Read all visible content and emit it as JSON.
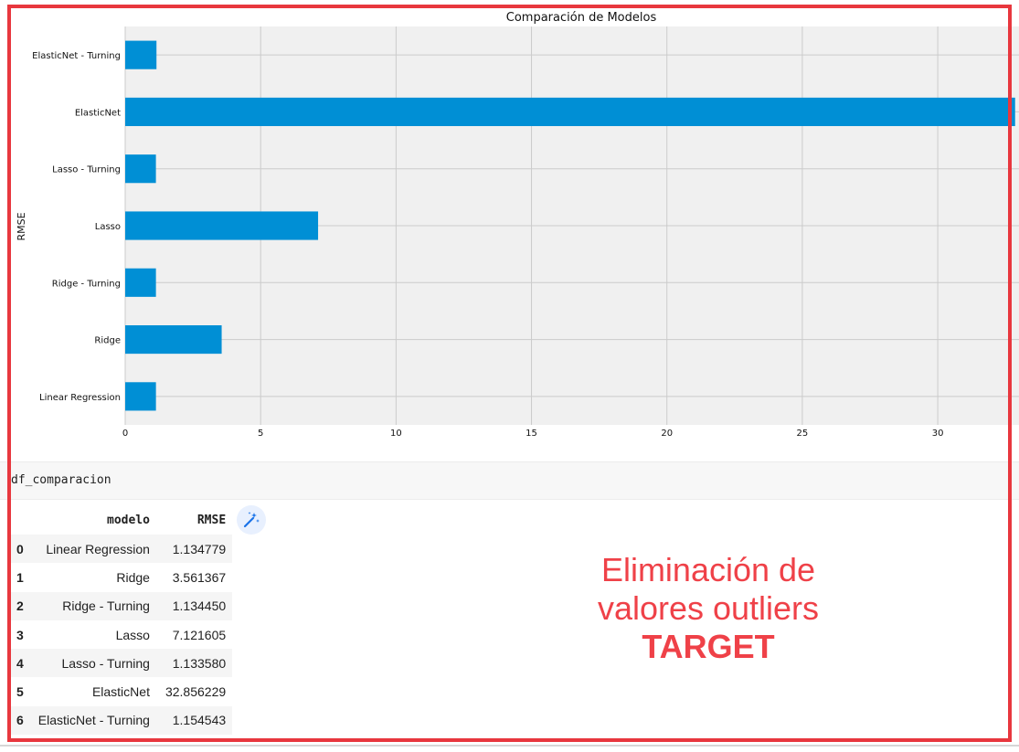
{
  "chart_data": {
    "type": "bar",
    "orientation": "horizontal",
    "title": "Comparación de Modelos",
    "xlabel": "",
    "ylabel": "RMSE",
    "categories": [
      "Linear Regression",
      "Ridge",
      "Ridge - Turning",
      "Lasso",
      "Lasso - Turning",
      "ElasticNet",
      "ElasticNet - Turning"
    ],
    "values": [
      1.134779,
      3.561367,
      1.13445,
      7.121605,
      1.13358,
      32.856229,
      1.154543
    ],
    "xlim": [
      0,
      33
    ],
    "xticks": [
      0,
      5,
      10,
      15,
      20,
      25,
      30
    ],
    "grid": true,
    "bar_color": "#008fd5",
    "background_color": "#f0f0f0"
  },
  "code_cell": {
    "text": "df_comparacion"
  },
  "table": {
    "columns": [
      "",
      "modelo",
      "RMSE"
    ],
    "rows": [
      {
        "index": "0",
        "modelo": "Linear Regression",
        "rmse": "1.134779"
      },
      {
        "index": "1",
        "modelo": "Ridge",
        "rmse": "3.561367"
      },
      {
        "index": "2",
        "modelo": "Ridge - Turning",
        "rmse": "1.134450"
      },
      {
        "index": "3",
        "modelo": "Lasso",
        "rmse": "7.121605"
      },
      {
        "index": "4",
        "modelo": "Lasso - Turning",
        "rmse": "1.133580"
      },
      {
        "index": "5",
        "modelo": "ElasticNet",
        "rmse": "32.856229"
      },
      {
        "index": "6",
        "modelo": "ElasticNet - Turning",
        "rmse": "1.154543"
      }
    ]
  },
  "toolbar": {
    "wand_icon": "magic-wand-icon"
  },
  "annotation": {
    "line1": "Eliminación de",
    "line2": "valores outliers",
    "line3": "TARGET",
    "color": "#ef4148"
  },
  "frame_color": "#e8373e"
}
